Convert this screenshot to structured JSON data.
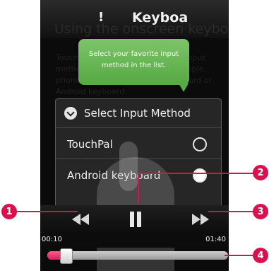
{
  "header": {
    "title": "Keyboa",
    "left_glyph": "!"
  },
  "background": {
    "heading": "Using the onscreen keyboard",
    "text": "Touch the keyboard to select the input method you want to use. For example, phones may use a TouchPal keyboard or Android keyboard."
  },
  "tooltip": {
    "text": "Select your favorite input method in the list."
  },
  "dialog": {
    "title": "Select Input Method",
    "options": [
      {
        "label": "TouchPal",
        "selected": false
      },
      {
        "label": "Android keyboard",
        "selected": true
      }
    ]
  },
  "player": {
    "controls": {
      "prev_icon": "rewind-icon",
      "pause_icon": "pause-icon",
      "next_icon": "fast-forward-icon"
    },
    "time_elapsed": "00:10",
    "time_total": "01:40",
    "progress": 0.1
  },
  "callouts": [
    "1",
    "2",
    "3",
    "4"
  ],
  "colors": {
    "callout": "#d9114d",
    "tooltip": "#6cbb58",
    "progress": "#e8346e"
  }
}
